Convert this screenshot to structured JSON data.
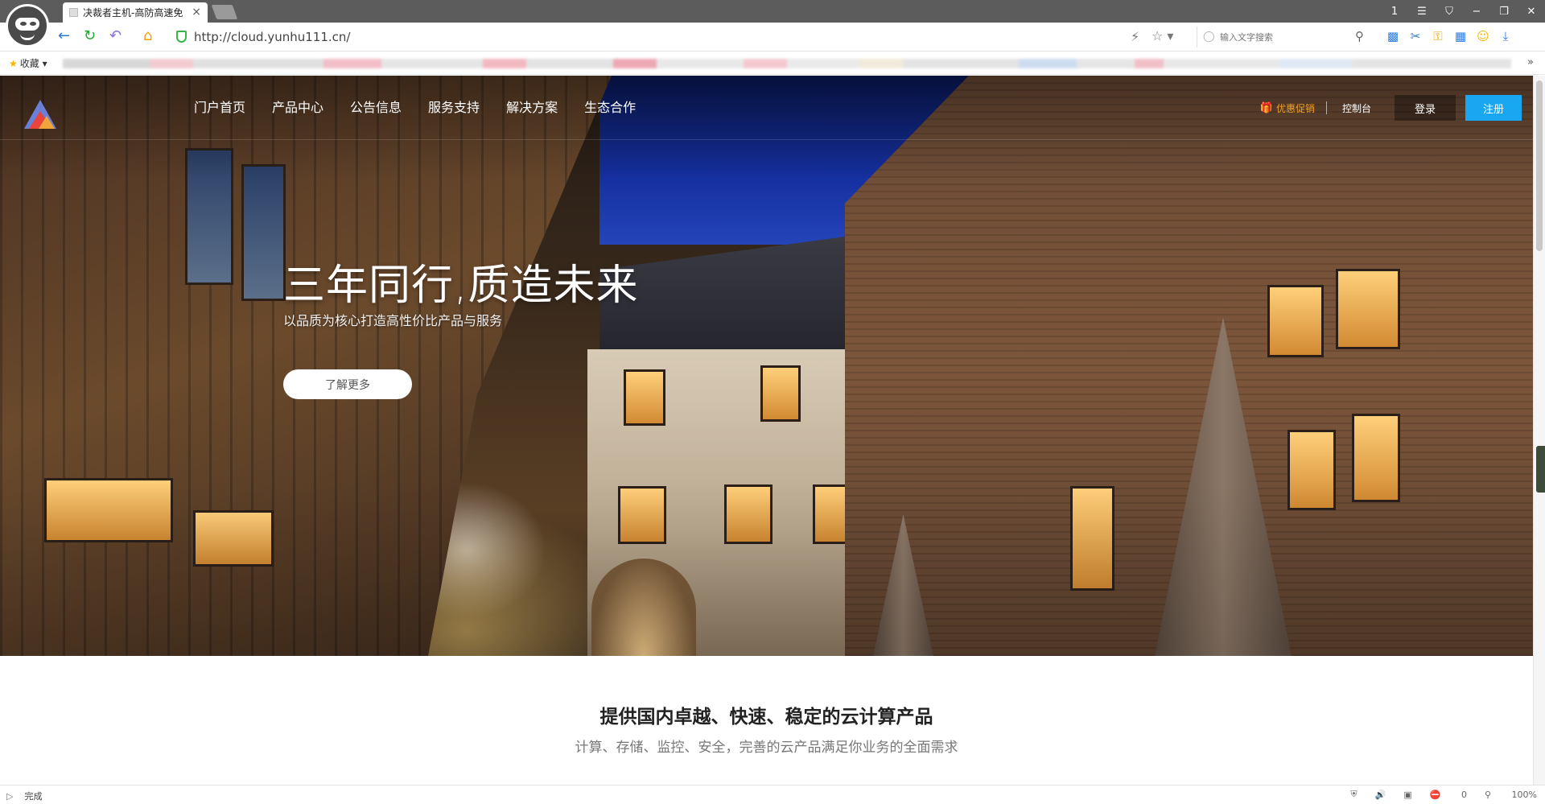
{
  "browser": {
    "tab_title": "决裁者主机-高防高速免",
    "tab_close": "×",
    "url": "http://cloud.yunhu111.cn/",
    "search_placeholder": "输入文字搜索",
    "bookmarks_label": "收藏",
    "bookmarks_more": "»",
    "window_controls": [
      "1",
      "☰",
      "⛉",
      "−",
      "❐",
      "✕"
    ],
    "icons": [
      "back-icon",
      "refresh-icon",
      "undo-icon",
      "home-icon",
      "shield-icon",
      "lightning-icon",
      "star-icon",
      "search-icon",
      "extension-icons",
      "download-icon"
    ]
  },
  "site": {
    "menu": [
      "门户首页",
      "产品中心",
      "公告信息",
      "服务支持",
      "解决方案",
      "生态合作"
    ],
    "promo": "优惠促销",
    "console": "控制台",
    "login": "登录",
    "register": "注册",
    "register_color": "#18a7f0",
    "promo_color": "#f2a12a"
  },
  "hero": {
    "title": "三年同行,质造未来",
    "subtitle": "以品质为核心打造高性价比产品与服务",
    "button": "了解更多"
  },
  "section": {
    "title": "提供国内卓越、快速、稳定的云计算产品",
    "subtitle": "计算、存储、监控、安全，完善的云产品满足你业务的全面需求"
  },
  "status": {
    "text": "完成",
    "counter": "0",
    "zoom": "100%"
  }
}
